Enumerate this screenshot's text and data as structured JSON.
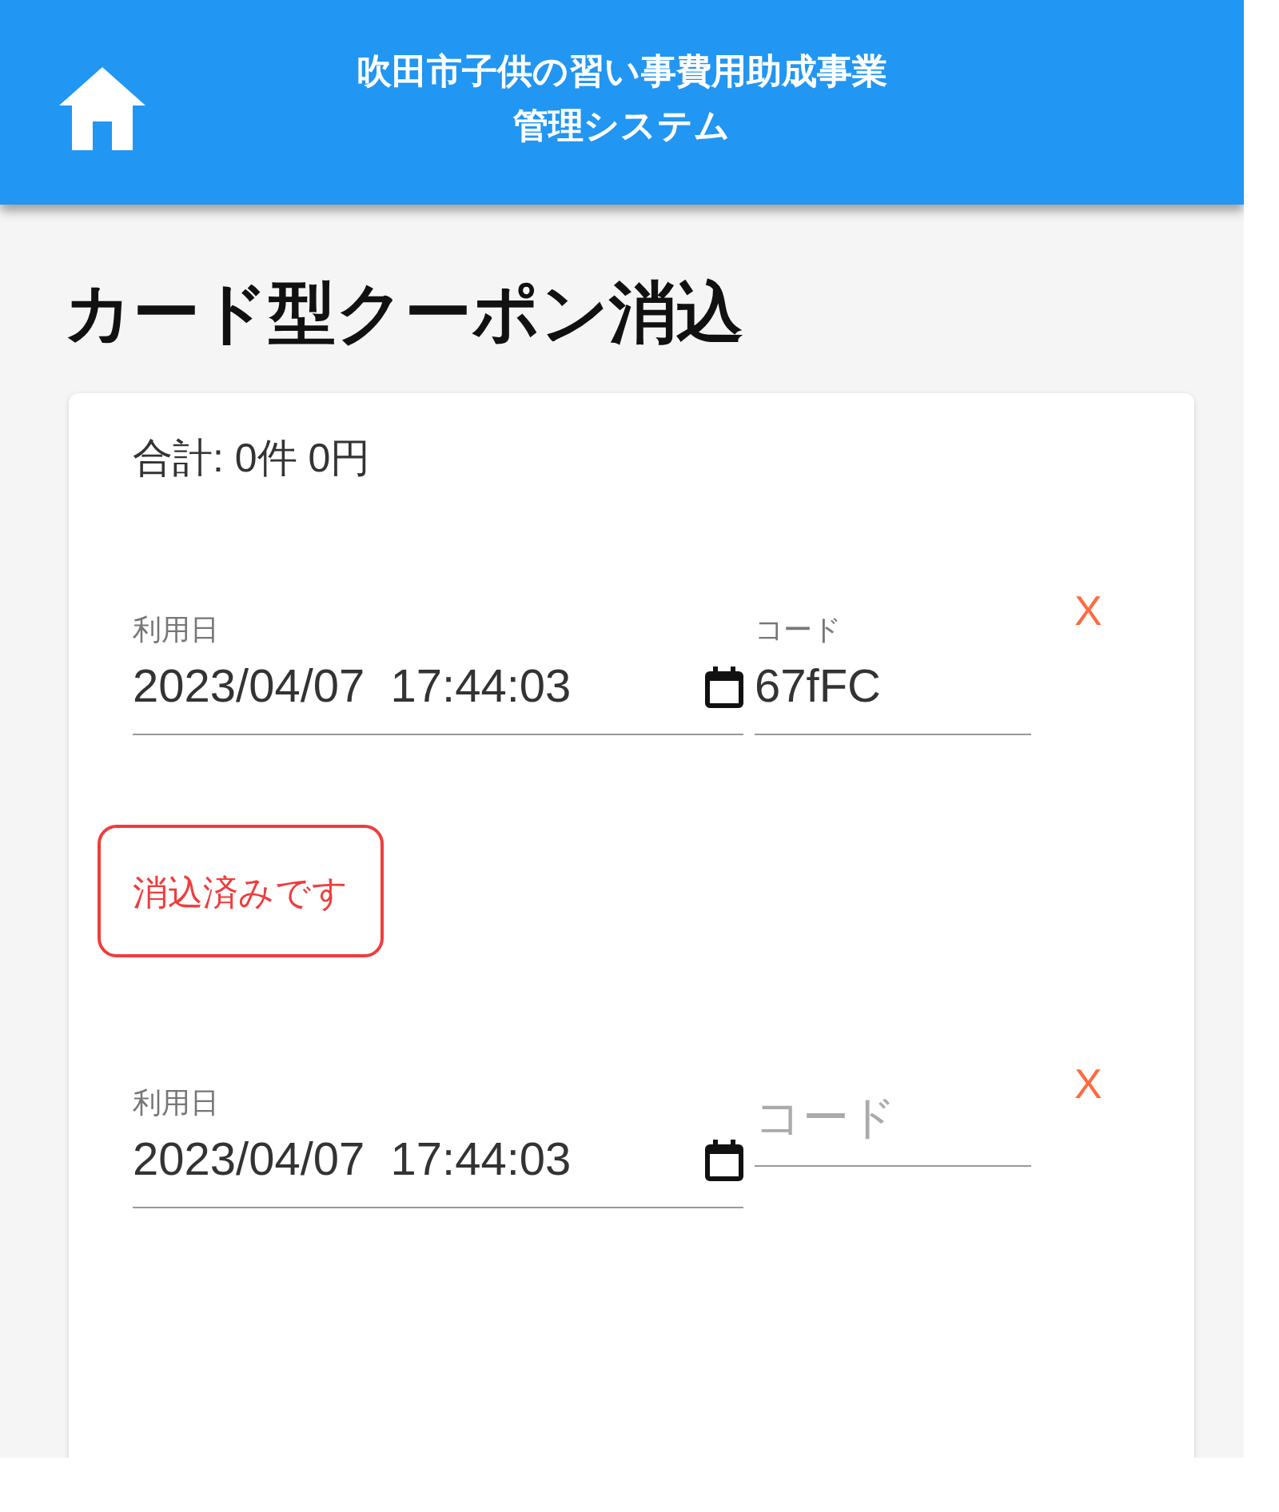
{
  "header": {
    "title_lines": [
      "吹田市子供の習い事費用助成事業",
      "管理システム"
    ]
  },
  "page_title": "カード型クーポン消込",
  "total": "合計: 0件 0円",
  "entries": [
    {
      "date_label": "利用日",
      "date_value": "2023/04/07  17:44:03",
      "code_label": "コード",
      "code_value": "67fFC",
      "remove": "X",
      "status": "消込済みです"
    },
    {
      "date_label": "利用日",
      "date_value": "2023/04/07  17:44:03",
      "code_placeholder": "コード",
      "remove": "X"
    }
  ]
}
